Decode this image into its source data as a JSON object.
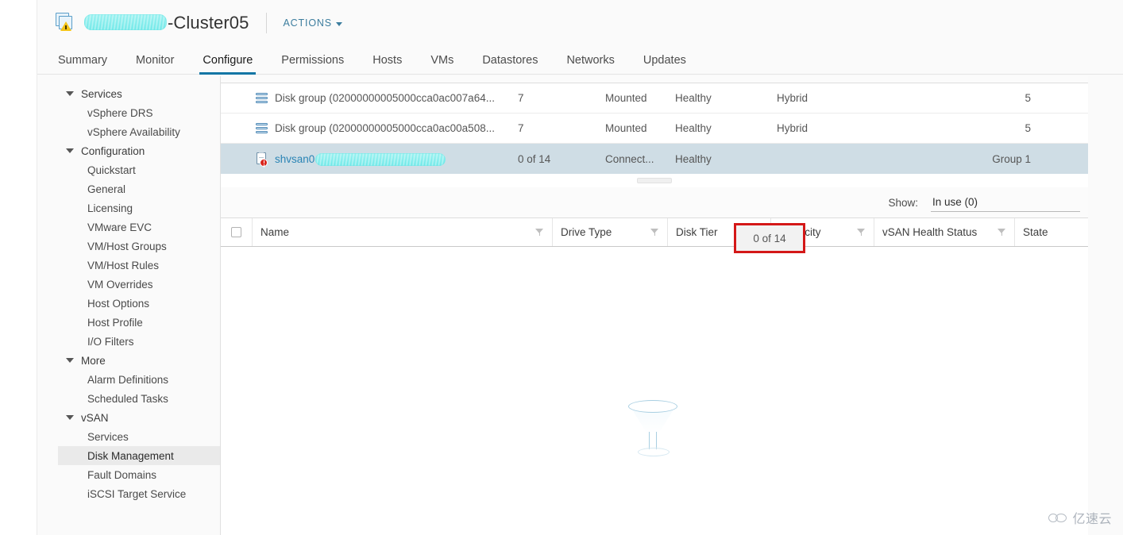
{
  "header": {
    "icon": "cluster-warning-icon",
    "title_suffix": "-Cluster05",
    "actions_label": "ACTIONS"
  },
  "tabs": [
    {
      "label": "Summary",
      "active": false
    },
    {
      "label": "Monitor",
      "active": false
    },
    {
      "label": "Configure",
      "active": true
    },
    {
      "label": "Permissions",
      "active": false
    },
    {
      "label": "Hosts",
      "active": false
    },
    {
      "label": "VMs",
      "active": false
    },
    {
      "label": "Datastores",
      "active": false
    },
    {
      "label": "Networks",
      "active": false
    },
    {
      "label": "Updates",
      "active": false
    }
  ],
  "sidebar": {
    "groups": [
      {
        "label": "Services",
        "items": [
          {
            "label": "vSphere DRS",
            "selected": false
          },
          {
            "label": "vSphere Availability",
            "selected": false
          }
        ]
      },
      {
        "label": "Configuration",
        "items": [
          {
            "label": "Quickstart",
            "selected": false
          },
          {
            "label": "General",
            "selected": false
          },
          {
            "label": "Licensing",
            "selected": false
          },
          {
            "label": "VMware EVC",
            "selected": false
          },
          {
            "label": "VM/Host Groups",
            "selected": false
          },
          {
            "label": "VM/Host Rules",
            "selected": false
          },
          {
            "label": "VM Overrides",
            "selected": false
          },
          {
            "label": "Host Options",
            "selected": false
          },
          {
            "label": "Host Profile",
            "selected": false
          },
          {
            "label": "I/O Filters",
            "selected": false
          }
        ]
      },
      {
        "label": "More",
        "items": [
          {
            "label": "Alarm Definitions",
            "selected": false
          },
          {
            "label": "Scheduled Tasks",
            "selected": false
          }
        ]
      },
      {
        "label": "vSAN",
        "items": [
          {
            "label": "Services",
            "selected": false
          },
          {
            "label": "Disk Management",
            "selected": true
          },
          {
            "label": "Fault Domains",
            "selected": false
          },
          {
            "label": "iSCSI Target Service",
            "selected": false
          }
        ]
      }
    ]
  },
  "disk_groups_table": {
    "rows": [
      {
        "icon": "disk-group-icon",
        "name": "Disk group (02000000005000cca0ac007a64...",
        "disks": "7",
        "state": "Mounted",
        "health": "Healthy",
        "type": "Hybrid",
        "fault_domain": "5",
        "selected": false
      },
      {
        "icon": "disk-group-icon",
        "name": "Disk group (02000000005000cca0ac00a508...",
        "disks": "7",
        "state": "Mounted",
        "health": "Healthy",
        "type": "Hybrid",
        "fault_domain": "5",
        "selected": false
      },
      {
        "icon": "host-error-icon",
        "name": "shvsan0",
        "disks": "0 of 14",
        "state": "Connect...",
        "health": "Healthy",
        "type": "",
        "fault_domain": "Group 1",
        "selected": true
      }
    ]
  },
  "annotation": {
    "highlighted_value": "0 of 14",
    "border_color": "#d41818"
  },
  "show_control": {
    "label": "Show:",
    "selected": "In use (0)"
  },
  "disks_table": {
    "columns": [
      {
        "label": "Name",
        "filterable": true
      },
      {
        "label": "Drive Type",
        "filterable": true
      },
      {
        "label": "Disk Tier",
        "filterable": true
      },
      {
        "label": "Capacity",
        "filterable": true
      },
      {
        "label": "vSAN Health Status",
        "filterable": true
      },
      {
        "label": "State",
        "filterable": false
      }
    ],
    "rows": [],
    "empty_icon": "funnel-filter-icon"
  },
  "watermark": {
    "text": "亿速云",
    "icon": "cloud-icon"
  }
}
